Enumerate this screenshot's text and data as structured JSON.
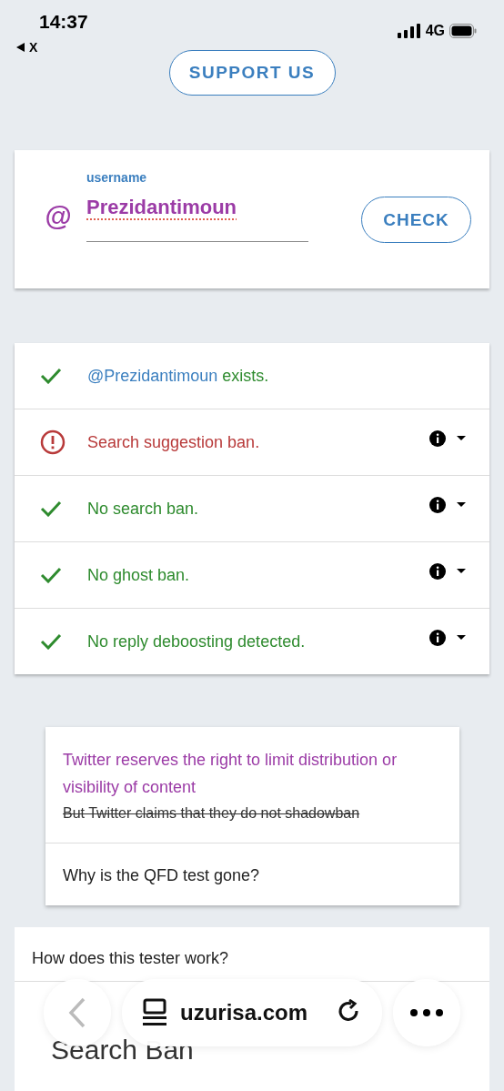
{
  "status_bar": {
    "time": "14:37",
    "back_app": "X",
    "network": "4G"
  },
  "support_button": {
    "label": "SUPPORT US"
  },
  "search_card": {
    "prefix": "@",
    "label": "username",
    "value": "Prezidantimoun",
    "button": "CHECK"
  },
  "results": [
    {
      "kind": "ok",
      "handle": "@Prezidantimoun",
      "text": "exists.",
      "expandable": false
    },
    {
      "kind": "warning",
      "text": "Search suggestion ban.",
      "expandable": true
    },
    {
      "kind": "ok",
      "text": "No search ban.",
      "expandable": true
    },
    {
      "kind": "ok",
      "text": "No ghost ban.",
      "expandable": true
    },
    {
      "kind": "ok",
      "text": "No reply deboosting detected.",
      "expandable": true
    }
  ],
  "notice_card": {
    "items": [
      {
        "kind": "statement",
        "title": "Twitter reserves the right to limit distribution or visibility of content",
        "struck": "But Twitter claims that they do not shadowban"
      },
      {
        "kind": "question",
        "title": "Why is the QFD test gone?"
      }
    ]
  },
  "faq_card": {
    "question": "How does this tester work?",
    "heading": "Search Ban"
  },
  "browser_bar": {
    "url": "uzurisa.com"
  }
}
